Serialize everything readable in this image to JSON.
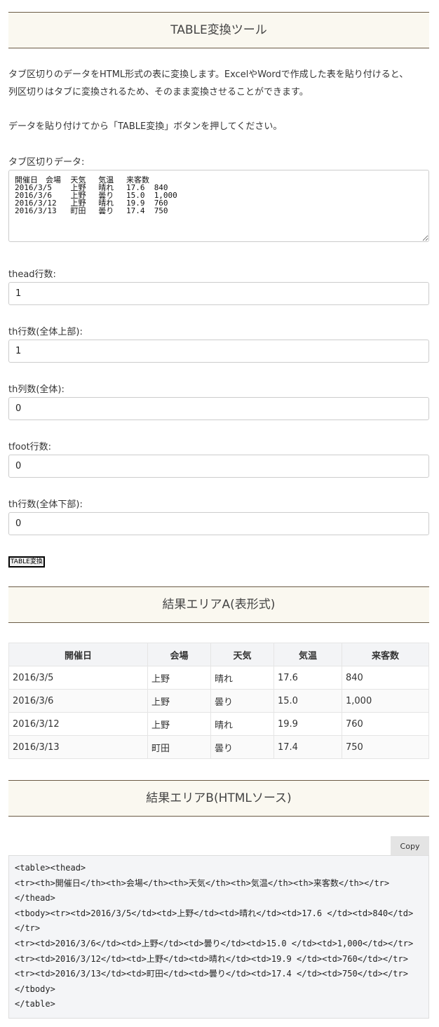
{
  "header": {
    "title": "TABLE変換ツール"
  },
  "intro": {
    "line1": "タブ区切りのデータをHTML形式の表に変換します。ExcelやWordで作成した表を貼り付けると、",
    "line2": "列区切りはタブに変換されるため、そのまま変換させることができます。",
    "line3": "データを貼り付けてから「TABLE変換」ボタンを押してください。"
  },
  "form": {
    "tsv_label": "タブ区切りデータ:",
    "tsv_value": "開催日　会場\t天気\t気温\t来客数\n2016/3/5\t上野\t晴れ\t17.6\t840\n2016/3/6\t上野\t曇り\t15.0\t1,000\n2016/3/12\t上野\t晴れ\t19.9\t760\n2016/3/13\t町田\t曇り\t17.4\t750",
    "thead_label": "thead行数:",
    "thead_value": "1",
    "th_top_label": "th行数(全体上部):",
    "th_top_value": "1",
    "th_col_label": "th列数(全体):",
    "th_col_value": "0",
    "tfoot_label": "tfoot行数:",
    "tfoot_value": "0",
    "th_bottom_label": "th行数(全体下部):",
    "th_bottom_value": "0",
    "convert_button": "TABLE変換"
  },
  "result_a": {
    "title": "結果エリアA(表形式)",
    "headers": [
      "開催日",
      "会場",
      "天気",
      "気温",
      "来客数"
    ],
    "rows": [
      [
        "2016/3/5",
        "上野",
        "晴れ",
        "17.6",
        "840"
      ],
      [
        "2016/3/6",
        "上野",
        "曇り",
        "15.0",
        "1,000"
      ],
      [
        "2016/3/12",
        "上野",
        "晴れ",
        "19.9",
        "760"
      ],
      [
        "2016/3/13",
        "町田",
        "曇り",
        "17.4",
        "750"
      ]
    ]
  },
  "result_b": {
    "title": "結果エリアB(HTMLソース)",
    "copy_button": "Copy",
    "source": "<table><thead>\n<tr><th>開催日</th><th>会場</th><th>天気</th><th>気温</th><th>来客数</th></tr>\n</thead>\n<tbody><tr><td>2016/3/5</td><td>上野</td><td>晴れ</td><td>17.6 </td><td>840</td>\n</tr>\n<tr><td>2016/3/6</td><td>上野</td><td>曇り</td><td>15.0 </td><td>1,000</td></tr>\n<tr><td>2016/3/12</td><td>上野</td><td>晴れ</td><td>19.9 </td><td>760</td></tr>\n<tr><td>2016/3/13</td><td>町田</td><td>曇り</td><td>17.4 </td><td>750</td></tr>\n</tbody>\n</table>"
  }
}
